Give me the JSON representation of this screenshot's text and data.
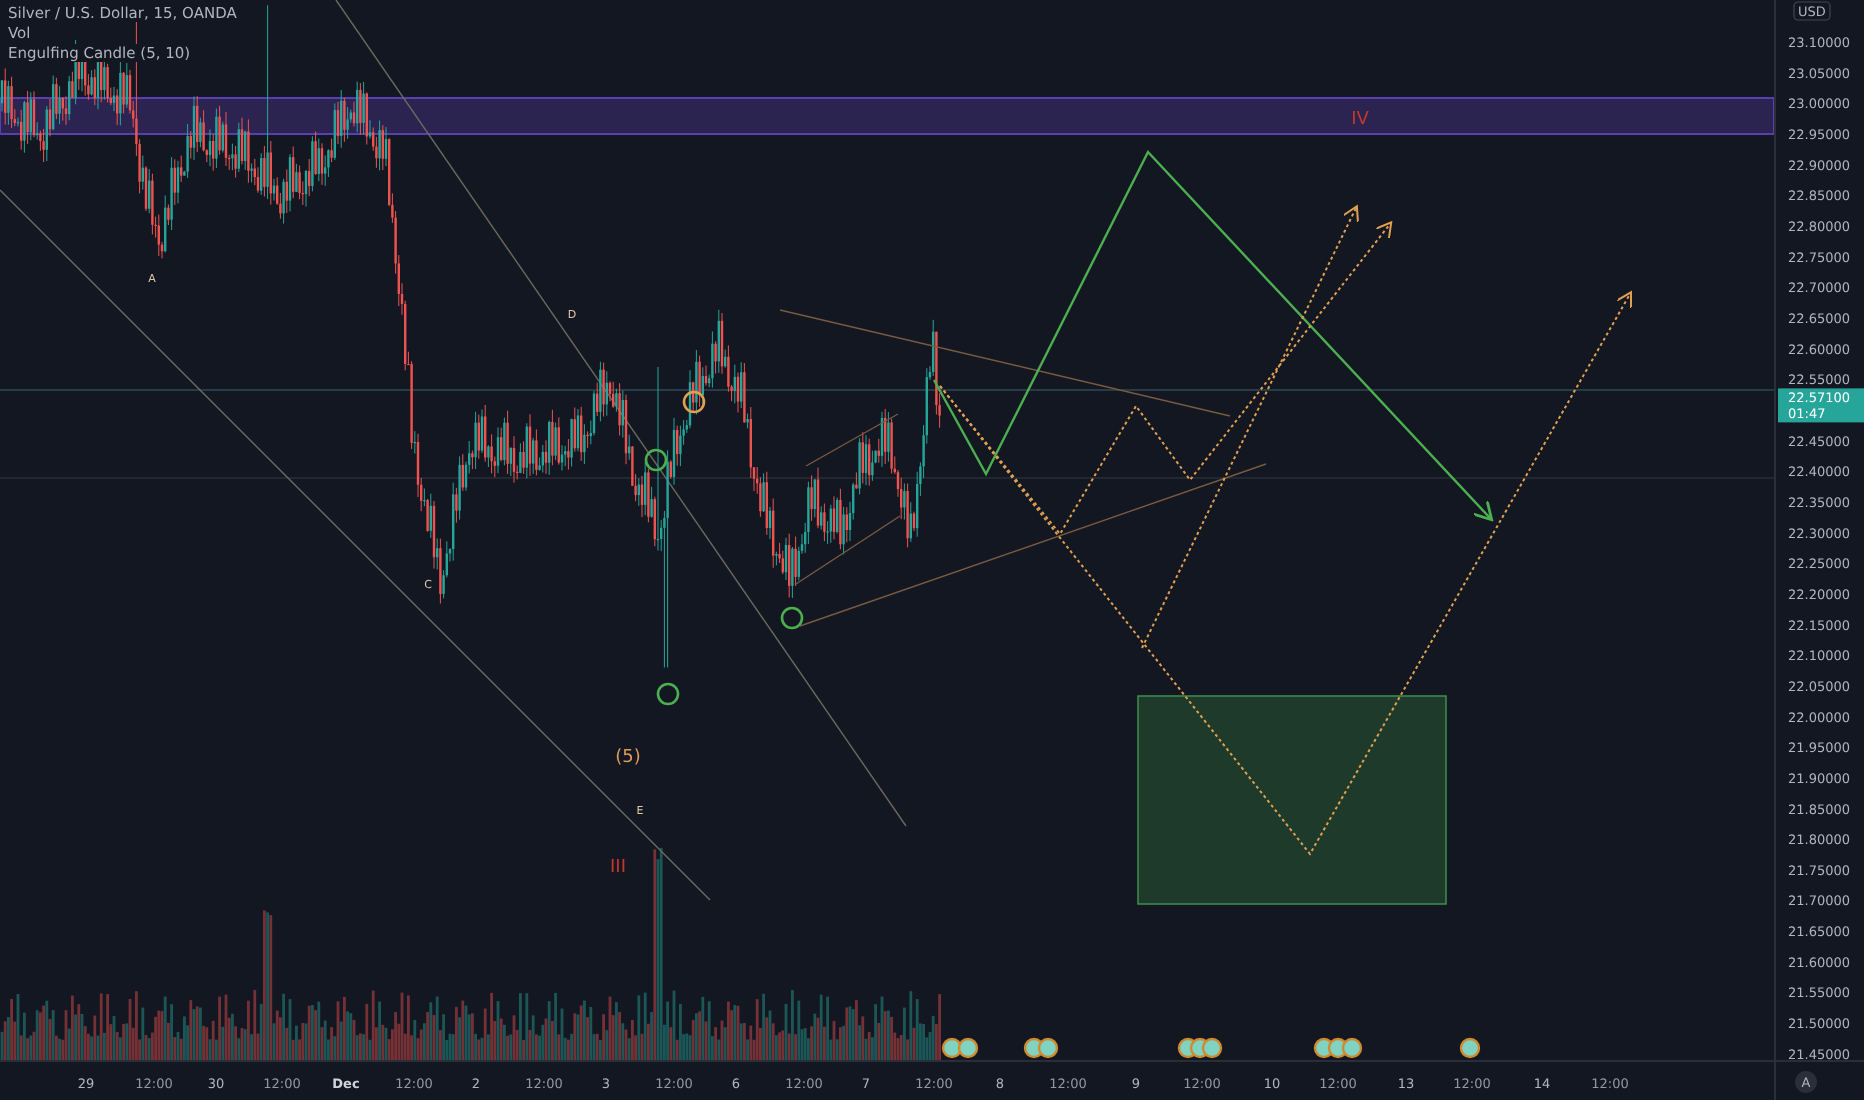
{
  "legend": [
    "Silver / U.S. Dollar, 15, OANDA",
    "Vol",
    "Engulfing Candle (5, 10)"
  ],
  "wave_labels": [
    {
      "text": "A",
      "color": "#e0c9a6"
    },
    {
      "text": "D",
      "color": "#e0c9a6"
    },
    {
      "text": "C",
      "color": "#e0c9a6"
    },
    {
      "text": "(5)",
      "color": "#e09a5a"
    },
    {
      "text": "E",
      "color": "#e0c9a6"
    },
    {
      "text": "III",
      "color": "#c0392b"
    },
    {
      "text": "IV",
      "color": "#c0392b"
    }
  ],
  "price_axis": {
    "currency": "USD",
    "labels": [
      "23.10000",
      "23.05000",
      "23.00000",
      "22.95000",
      "22.90000",
      "22.85000",
      "22.80000",
      "22.75000",
      "22.70000",
      "22.65000",
      "22.60000",
      "22.55000",
      "22.45000",
      "22.40000",
      "22.35000",
      "22.30000",
      "22.25000",
      "22.20000",
      "22.15000",
      "22.10000",
      "22.05000",
      "22.00000",
      "21.95000",
      "21.90000",
      "21.85000",
      "21.80000",
      "21.75000",
      "21.70000",
      "21.65000",
      "21.60000",
      "21.55000",
      "21.50000",
      "21.45000"
    ],
    "last_price": {
      "price": "22.57100",
      "countdown": "01:47"
    },
    "auto_button": "A"
  },
  "time_axis": [
    {
      "label": "29",
      "kind": "day"
    },
    {
      "label": "12:00",
      "kind": "time"
    },
    {
      "label": "30",
      "kind": "day"
    },
    {
      "label": "12:00",
      "kind": "time"
    },
    {
      "label": "Dec",
      "kind": "month"
    },
    {
      "label": "12:00",
      "kind": "time"
    },
    {
      "label": "2",
      "kind": "day"
    },
    {
      "label": "12:00",
      "kind": "time"
    },
    {
      "label": "3",
      "kind": "day"
    },
    {
      "label": "12:00",
      "kind": "time"
    },
    {
      "label": "6",
      "kind": "day"
    },
    {
      "label": "12:00",
      "kind": "time"
    },
    {
      "label": "7",
      "kind": "day"
    },
    {
      "label": "12:00",
      "kind": "time"
    },
    {
      "label": "8",
      "kind": "day"
    },
    {
      "label": "12:00",
      "kind": "time"
    },
    {
      "label": "9",
      "kind": "day"
    },
    {
      "label": "12:00",
      "kind": "time"
    },
    {
      "label": "10",
      "kind": "day"
    },
    {
      "label": "12:00",
      "kind": "time"
    },
    {
      "label": "13",
      "kind": "day"
    },
    {
      "label": "12:00",
      "kind": "time"
    },
    {
      "label": "14",
      "kind": "day"
    },
    {
      "label": "12:00",
      "kind": "time"
    }
  ]
}
